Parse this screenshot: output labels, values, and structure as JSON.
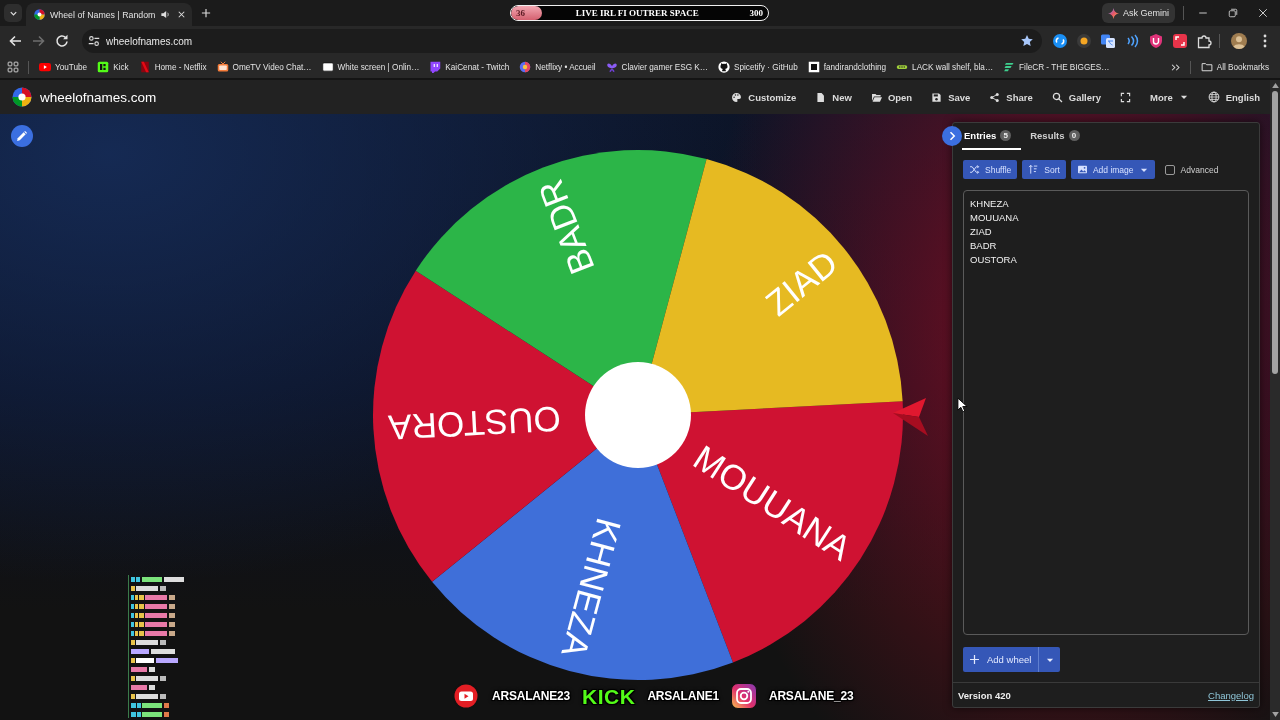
{
  "browser": {
    "tabs": [
      {
        "title": "Wheel of Names | Random",
        "playing_audio": true,
        "selected": true
      }
    ],
    "stream_banner": {
      "count": "36",
      "title": "LIVE IRL FI OUTRER SPACE",
      "goal": "300",
      "level": 0.12
    },
    "assistant_button": "Ask Gemini",
    "address": "wheelofnames.com",
    "bookmarked": true,
    "bookmarks": [
      "YouTube",
      "Kick",
      "Home - Netflix",
      "OmeTV Video Chat…",
      "White screen | Onlin…",
      "KaiCenat - Twitch",
      "Netflixy • Accueil",
      "Clavier gamer ESG K…",
      "Spicetify · GitHub",
      "fandirandclothing",
      "LACK wall shelf, bla…",
      "FileCR - THE BIGGES…"
    ],
    "all_bookmarks": "All Bookmarks"
  },
  "app": {
    "site_title": "wheelofnames.com",
    "menu": [
      "Customize",
      "New",
      "Open",
      "Save",
      "Share",
      "Gallery"
    ],
    "more": "More",
    "language": "English"
  },
  "wheel": {
    "segments": [
      {
        "label": "MOUUANA",
        "color": "#cf1232"
      },
      {
        "label": "KHNEZA",
        "color": "#3f6fd9"
      },
      {
        "label": "OUSTORA",
        "color": "#cf1232"
      },
      {
        "label": "BADR",
        "color": "#2cb548"
      },
      {
        "label": "ZIAD",
        "color": "#e6ba22"
      }
    ]
  },
  "panel": {
    "tabs": [
      {
        "label": "Entries",
        "count": "5",
        "selected": true
      },
      {
        "label": "Results",
        "count": "0",
        "selected": false
      }
    ],
    "actions": [
      {
        "label": "Shuffle",
        "kind": "button"
      },
      {
        "label": "Sort",
        "kind": "button"
      },
      {
        "label": "Add image",
        "kind": "dropdown"
      }
    ],
    "advanced": {
      "label": "Advanced",
      "checked": false
    },
    "entries": [
      "KHNEZA",
      "MOUUANA",
      "ZIAD",
      "BADR",
      "OUSTORA"
    ],
    "add_wheel": "Add wheel",
    "version": "Version 420",
    "changelog": "Changelog"
  },
  "socials": [
    {
      "kind": "play",
      "handle": "ARSALANE23"
    },
    {
      "kind": "wordmark",
      "logo": "KICK",
      "handle": "ARSALANE1"
    },
    {
      "kind": "camera",
      "handle": "ARSALANE_23"
    }
  ]
}
